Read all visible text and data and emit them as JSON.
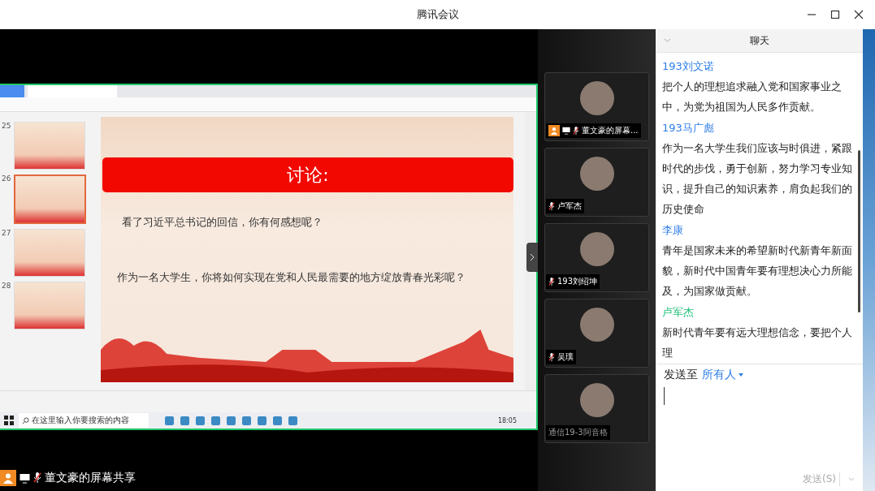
{
  "window": {
    "title": "腾讯会议"
  },
  "shared_screen": {
    "slides": [
      {
        "number": "25",
        "selected": false
      },
      {
        "number": "26",
        "selected": true
      },
      {
        "number": "27",
        "selected": false
      },
      {
        "number": "28",
        "selected": false
      }
    ],
    "slide": {
      "title": "讨论:",
      "questions": [
        "看了习近平总书记的回信，你有何感想呢？",
        "作为一名大学生，你将如何实现在党和人民最需要的地方绽放青春光彩呢？"
      ]
    },
    "taskbar": {
      "search_placeholder": "在这里输入你要搜索的内容",
      "time": "18:05"
    },
    "sharer_label": "董文豪的屏幕共享"
  },
  "participants": [
    {
      "name": "董文豪的屏幕...",
      "muted": true,
      "screen_sharing": true
    },
    {
      "name": "卢军杰",
      "muted": true,
      "screen_sharing": false
    },
    {
      "name": "193刘绍坤",
      "muted": true,
      "screen_sharing": false
    },
    {
      "name": "吴璞",
      "muted": true,
      "screen_sharing": false
    },
    {
      "name": "通信19-3阿音格",
      "muted": false,
      "screen_sharing": false
    }
  ],
  "chat": {
    "title": "聊天",
    "messages": [
      {
        "sender": "193刘文诺",
        "color": "#2e7de6",
        "text": "把个人的理想追求融入党和国家事业之中，为党为祖国为人民多作贡献。"
      },
      {
        "sender": "193马广彪",
        "color": "#2e7de6",
        "text": "作为一名大学生我们应该与时俱进，紧跟时代的步伐，勇于创新，努力学习专业知识，提升自己的知识素养，肩负起我们的历史使命"
      },
      {
        "sender": "李康",
        "color": "#2e7de6",
        "text": "青年是国家未来的希望新时代新青年新面貌，新时代中国青年要有理想决心力所能及，为国家做贡献。"
      },
      {
        "sender": "卢军杰",
        "color": "#22c27a",
        "text": "新时代青年要有远大理想信念，要把个人理"
      }
    ],
    "send_to_label": "发送至",
    "recipient": "所有人",
    "send_button": "发送(S)"
  }
}
